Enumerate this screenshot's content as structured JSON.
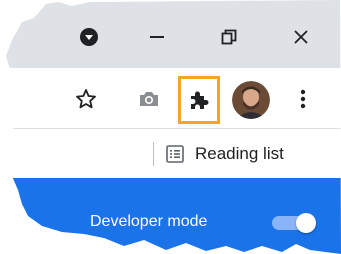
{
  "window_controls": {
    "profile_menu_icon": "dropdown-circle",
    "minimize_icon": "minimize",
    "restore_icon": "restore",
    "close_icon": "close"
  },
  "toolbar": {
    "bookmark_icon": "star-outline",
    "screenshot_icon": "camera",
    "extensions_icon": "puzzle-piece",
    "extensions_highlight_color": "#f5a623",
    "profile": "avatar",
    "menu_icon": "vertical-dots"
  },
  "bookmarks_bar": {
    "reading_list_icon": "list",
    "reading_list_label": "Reading list"
  },
  "extensions_bar": {
    "background_color": "#1a73e8",
    "developer_mode_label": "Developer mode",
    "developer_mode_enabled": true
  }
}
